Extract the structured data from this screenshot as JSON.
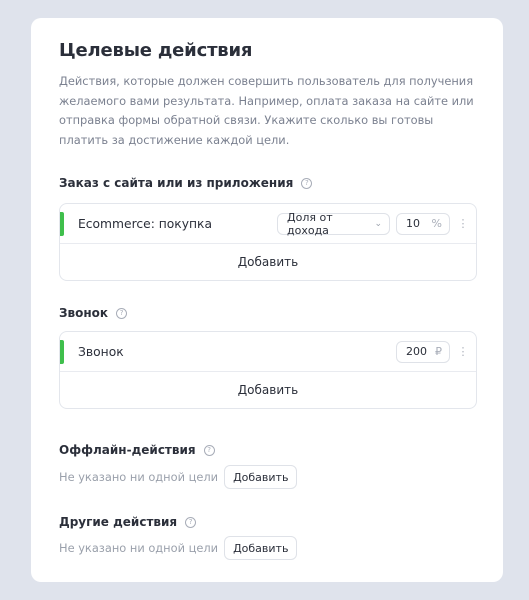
{
  "title": "Целевые действия",
  "description": "Действия, которые должен совершить пользователь для получения желаемого вами результата. Например, оплата заказа на сайте или отправка формы обратной связи. Укажите сколько вы готовы платить за достижение каждой цели.",
  "sections": {
    "order": {
      "heading": "Заказ с сайта или из приложения",
      "help": "?",
      "goal": {
        "name": "Ecommerce: покупка",
        "payment_model": "Доля от дохода",
        "value": "10",
        "unit": "%"
      },
      "add_label": "Добавить"
    },
    "call": {
      "heading": "Звонок",
      "help": "?",
      "goal": {
        "name": "Звонок",
        "value": "200",
        "unit": "₽"
      },
      "add_label": "Добавить"
    },
    "offline": {
      "heading": "Оффлайн-действия",
      "help": "?",
      "empty_text": "Не указано ни одной цели",
      "add_label": "Добавить"
    },
    "other": {
      "heading": "Другие действия",
      "help": "?",
      "empty_text": "Не указано ни одной цели",
      "add_label": "Добавить"
    }
  },
  "icons": {
    "chevron": "chevron-down-icon",
    "more": "more-vertical-icon",
    "help": "question-circle-icon"
  },
  "colors": {
    "accent_green": "#3fbf4c",
    "background": "#dfe3ec"
  }
}
